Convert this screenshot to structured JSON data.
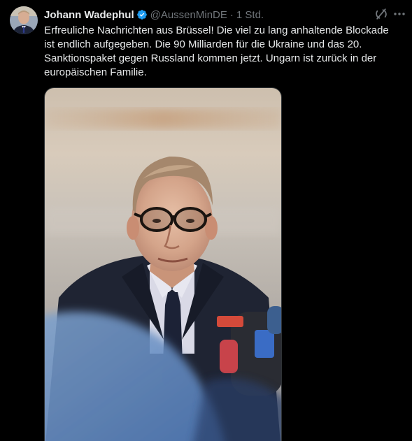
{
  "tweet": {
    "author_name": "Johann Wadephul",
    "handle": "@AussenMinDE",
    "separator": "·",
    "time": "1 Std.",
    "text": "Erfreuliche Nachrichten aus Brüssel! Die viel zu lang anhaltende Blockade ist endlich aufgegeben. Die 90 Milliarden für die Ukraine und das 20. Sanktionspaket gegen Russland kommen jetzt. Ungarn ist zurück in der europäischen Familie.",
    "verified_icon": "verified-badge-icon",
    "grok_icon": "grok-icon",
    "more_icon": "more-options-icon",
    "photo_description_icon": "photo-of-man-at-microphones"
  },
  "colors": {
    "background": "#000000",
    "text_primary": "#e7e9ea",
    "text_secondary": "#71767b",
    "verified": "#1d9bf0"
  }
}
